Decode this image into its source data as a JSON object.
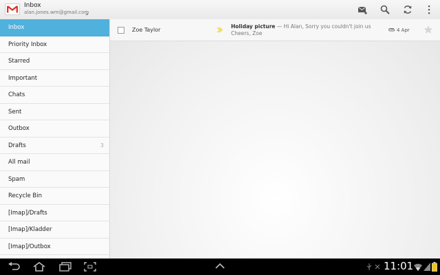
{
  "header": {
    "title": "Inbox",
    "account_email": "alan.jones.wm@gmail.com",
    "icons": [
      "compose-icon",
      "search-icon",
      "refresh-icon",
      "overflow-menu-icon"
    ]
  },
  "sidebar": {
    "items": [
      {
        "label": "Inbox",
        "count": "",
        "active": true
      },
      {
        "label": "Priority Inbox",
        "count": ""
      },
      {
        "label": "Starred",
        "count": ""
      },
      {
        "label": "Important",
        "count": ""
      },
      {
        "label": "Chats",
        "count": ""
      },
      {
        "label": "Sent",
        "count": ""
      },
      {
        "label": "Outbox",
        "count": ""
      },
      {
        "label": "Drafts",
        "count": "3"
      },
      {
        "label": "All mail",
        "count": ""
      },
      {
        "label": "Spam",
        "count": ""
      },
      {
        "label": "Recycle Bin",
        "count": ""
      },
      {
        "label": "[Imap]/Drafts",
        "count": ""
      },
      {
        "label": "[Imap]/Kladder",
        "count": ""
      },
      {
        "label": "[Imap]/Outbox",
        "count": ""
      }
    ]
  },
  "messages": [
    {
      "sender": "Zoe Taylor",
      "subject": "Holiday picture",
      "separator": " — ",
      "snippet": "Hi Alan, Sorry you couldn't join us",
      "snippet_line2": "Cheers, Zoe",
      "date": "4 Apr",
      "has_attachment": true,
      "important": true,
      "starred": false
    }
  ],
  "statusbar": {
    "time": "11:01"
  },
  "colors": {
    "accent": "#4fb1dc",
    "important": "#f2d22e"
  }
}
